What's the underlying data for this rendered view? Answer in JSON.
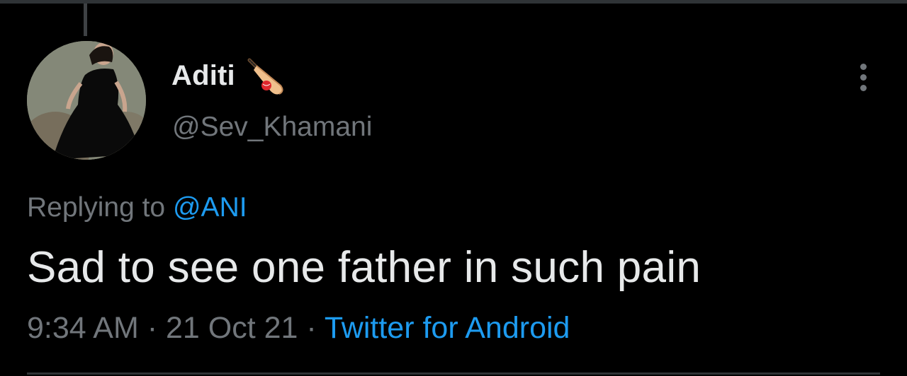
{
  "tweet": {
    "display_name": "Aditi",
    "name_emoji": "cricket-bat-icon",
    "handle": "@Sev_Khamani",
    "replying_prefix": "Replying to",
    "replying_to": "@ANI",
    "text": "Sad to see one father in such pain",
    "time": "9:34 AM",
    "separator": "·",
    "date": "21 Oct 21",
    "source": "Twitter for Android"
  },
  "colors": {
    "background": "#000000",
    "primary_text": "#e7e9ea",
    "secondary_text": "#71767b",
    "accent": "#1d9bf0"
  }
}
